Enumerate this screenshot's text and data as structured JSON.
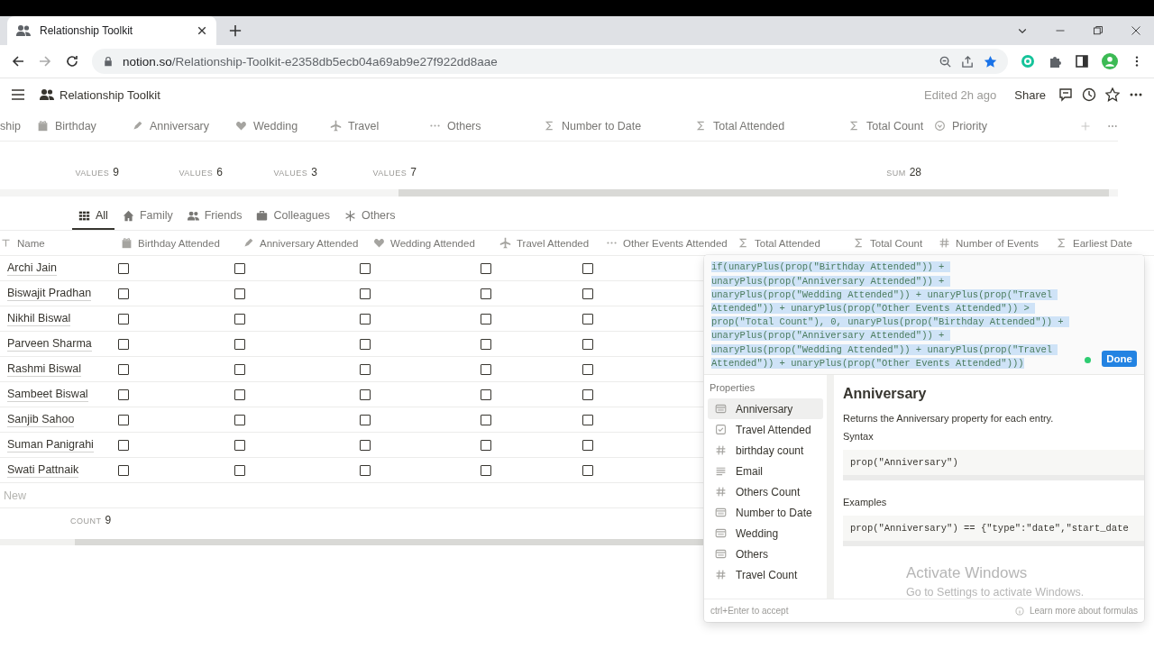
{
  "browser": {
    "tab_title": "Relationship Toolkit",
    "url_domain": "notion.so",
    "url_path": "/Relationship-Toolkit-e2358db5ecb04a69ab9e27f922dd8aae"
  },
  "topbar": {
    "breadcrumb": "Relationship Toolkit",
    "edited": "Edited 2h ago",
    "share": "Share"
  },
  "properties_header": [
    {
      "label": "ship",
      "kind": "none"
    },
    {
      "label": "Birthday",
      "kind": "gift",
      "calculation": {
        "label": "VALUES",
        "value": "9"
      }
    },
    {
      "label": "Anniversary",
      "kind": "pen",
      "calculation": {
        "label": "VALUES",
        "value": "6"
      }
    },
    {
      "label": "Wedding",
      "kind": "heart",
      "calculation": {
        "label": "VALUES",
        "value": "3"
      }
    },
    {
      "label": "Travel",
      "kind": "plane",
      "calculation": {
        "label": "VALUES",
        "value": "7"
      }
    },
    {
      "label": "Others",
      "kind": "dots"
    },
    {
      "label": "Number to Date",
      "kind": "formula"
    },
    {
      "label": "Total Attended",
      "kind": "formula"
    },
    {
      "label": "Total Count",
      "kind": "formula",
      "calculation": {
        "label": "SUM",
        "value": "28"
      }
    },
    {
      "label": "Priority",
      "kind": "select"
    }
  ],
  "views": [
    {
      "label": "All",
      "kind": "grid",
      "selected": true
    },
    {
      "label": "Family",
      "kind": "house",
      "selected": false
    },
    {
      "label": "Friends",
      "kind": "people",
      "selected": false
    },
    {
      "label": "Colleagues",
      "kind": "briefcase",
      "selected": false
    },
    {
      "label": "Others",
      "kind": "asterisk",
      "selected": false
    }
  ],
  "table": {
    "columns": [
      {
        "label": "Name",
        "kind": "title"
      },
      {
        "label": "Birthday Attended",
        "kind": "gift"
      },
      {
        "label": "Anniversary Attended",
        "kind": "pen"
      },
      {
        "label": "Wedding Attended",
        "kind": "heart"
      },
      {
        "label": "Travel Attended",
        "kind": "plane"
      },
      {
        "label": "Other Events Attended",
        "kind": "dots"
      },
      {
        "label": "Total Attended",
        "kind": "formula"
      },
      {
        "label": "Total Count",
        "kind": "formula"
      },
      {
        "label": "Number of Events",
        "kind": "number"
      },
      {
        "label": "Earliest Date",
        "kind": "formula"
      }
    ],
    "rows": [
      {
        "name": "Archi Jain",
        "checks": [
          false,
          false,
          false,
          false,
          false
        ]
      },
      {
        "name": "Biswajit Pradhan",
        "checks": [
          false,
          false,
          false,
          false,
          false
        ]
      },
      {
        "name": "Nikhil Biswal",
        "checks": [
          false,
          false,
          false,
          false,
          false
        ]
      },
      {
        "name": "Parveen Sharma",
        "checks": [
          false,
          false,
          false,
          false,
          false
        ]
      },
      {
        "name": "Rashmi Biswal",
        "checks": [
          false,
          false,
          false,
          false,
          false
        ]
      },
      {
        "name": "Sambeet Biswal",
        "checks": [
          false,
          false,
          false,
          false,
          false
        ]
      },
      {
        "name": "Sanjib Sahoo",
        "checks": [
          false,
          false,
          false,
          false,
          false
        ]
      },
      {
        "name": "Suman Panigrahi",
        "checks": [
          false,
          false,
          false,
          false,
          false
        ]
      },
      {
        "name": "Swati Pattnaik",
        "checks": [
          false,
          false,
          false,
          false,
          false
        ]
      }
    ],
    "new_row": "New",
    "footer": {
      "label": "COUNT",
      "value": "9"
    }
  },
  "formula_editor": {
    "code": "if(unaryPlus(prop(\"Birthday Attended\")) + unaryPlus(prop(\"Anniversary Attended\")) + unaryPlus(prop(\"Wedding Attended\")) + unaryPlus(prop(\"Travel Attended\")) + unaryPlus(prop(\"Other Events Attended\")) > prop(\"Total Count\"), 0, unaryPlus(prop(\"Birthday Attended\")) + unaryPlus(prop(\"Anniversary Attended\")) + unaryPlus(prop(\"Wedding Attended\")) + unaryPlus(prop(\"Travel Attended\")) + unaryPlus(prop(\"Other Events Attended\")))",
    "done": "Done",
    "properties_heading": "Properties",
    "properties": [
      {
        "label": "Anniversary",
        "kind": "date",
        "selected": true
      },
      {
        "label": "Travel Attended",
        "kind": "checkbox",
        "selected": false
      },
      {
        "label": "birthday count",
        "kind": "number",
        "selected": false
      },
      {
        "label": "Email",
        "kind": "text",
        "selected": false
      },
      {
        "label": "Others Count",
        "kind": "number",
        "selected": false
      },
      {
        "label": "Number to Date",
        "kind": "date",
        "selected": false
      },
      {
        "label": "Wedding",
        "kind": "date",
        "selected": false
      },
      {
        "label": "Others",
        "kind": "date",
        "selected": false
      },
      {
        "label": "Travel Count",
        "kind": "number",
        "selected": false
      }
    ],
    "detail": {
      "title": "Anniversary",
      "description": "Returns the Anniversary property for each entry.",
      "syntax_heading": "Syntax",
      "syntax": "prop(\"Anniversary\")",
      "examples_heading": "Examples",
      "example": "prop(\"Anniversary\") == {\"type\":\"date\",\"start_date"
    },
    "hint": "ctrl+Enter to accept",
    "learn_more": "Learn more about formulas"
  },
  "os_notice": {
    "title": "Activate Windows",
    "subtitle": "Go to Settings to activate Windows."
  }
}
